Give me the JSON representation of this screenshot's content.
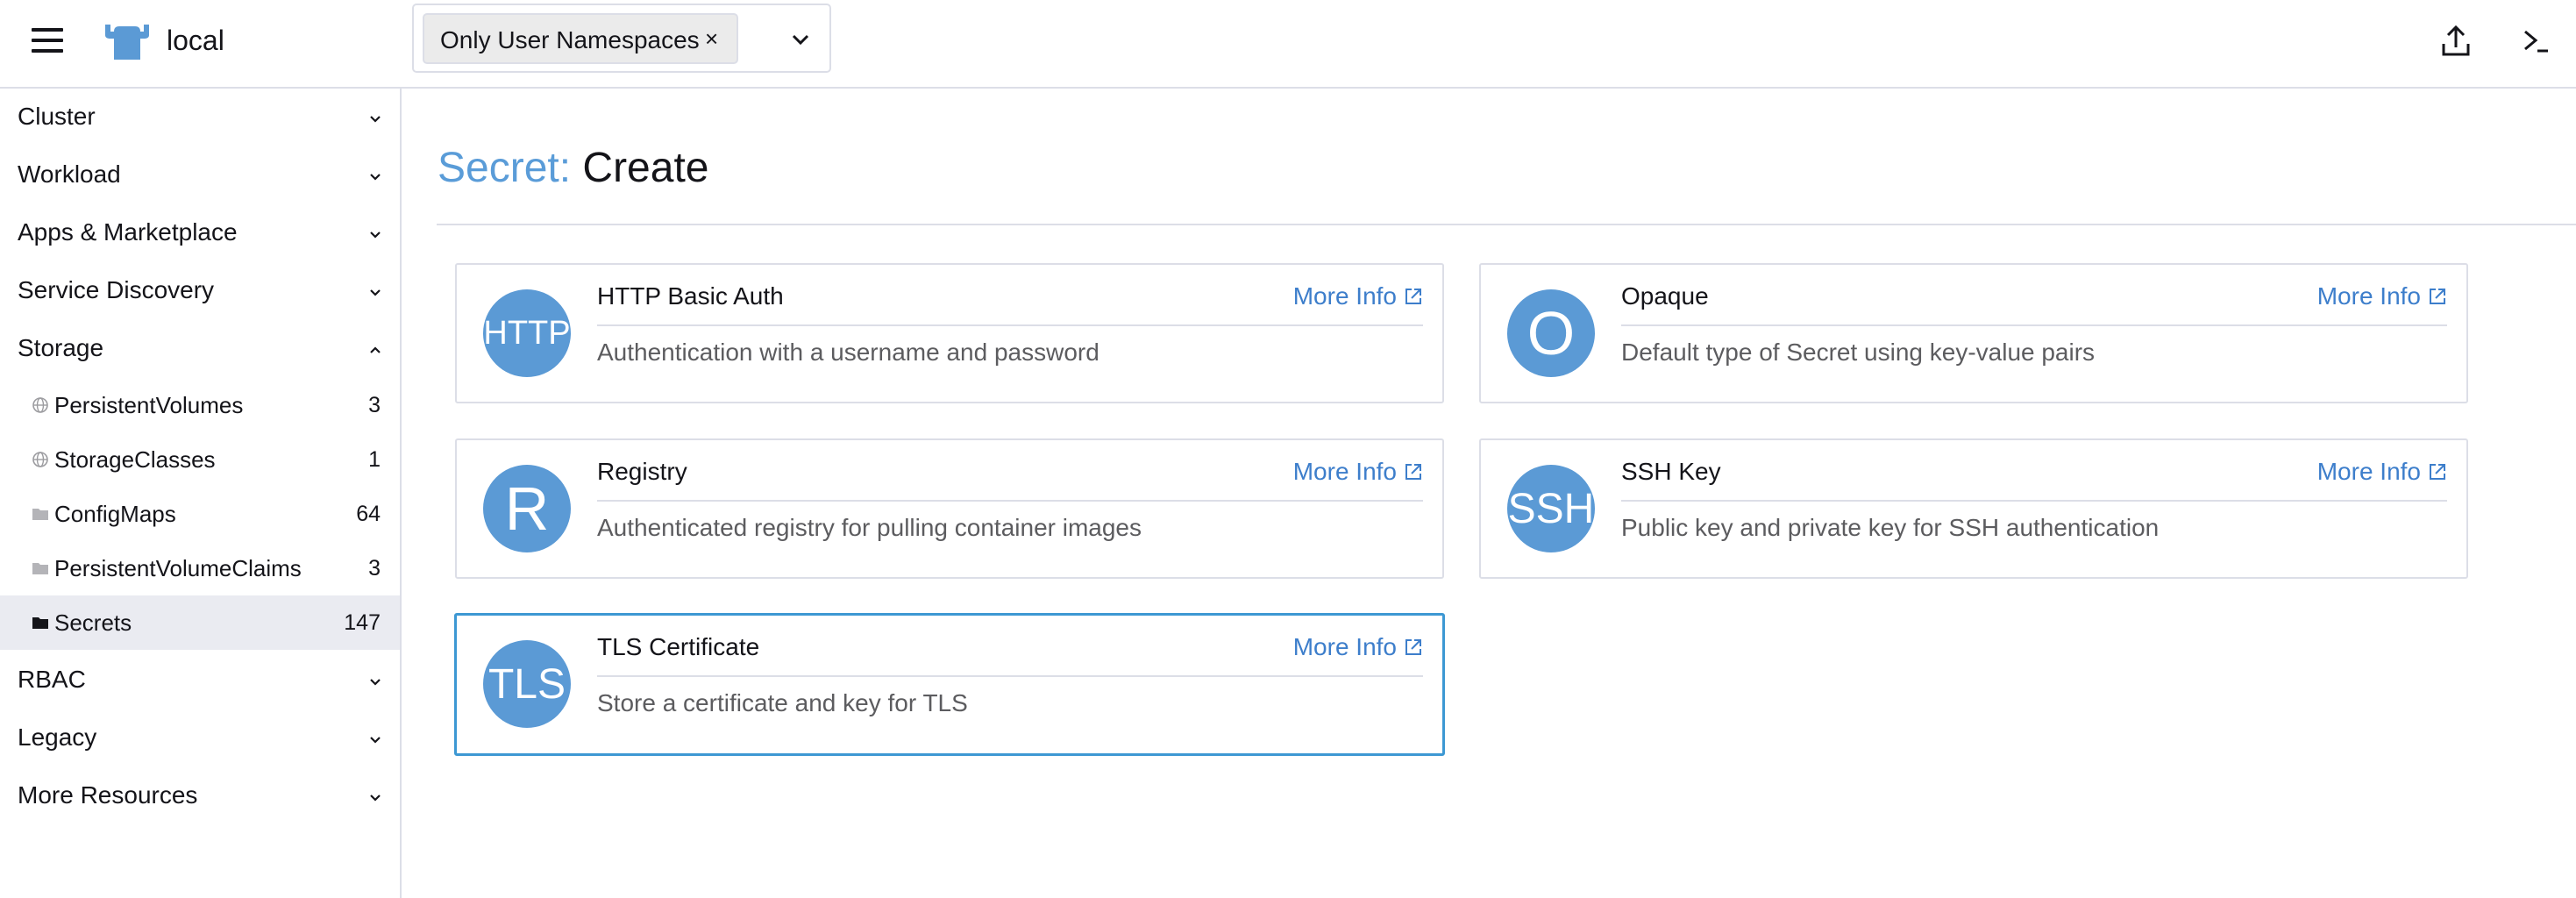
{
  "header": {
    "cluster_name": "local",
    "namespace_filter": {
      "selected_chip": "Only User Namespaces",
      "chip_close_glyph": "×"
    },
    "icons": [
      "menu-icon",
      "rancher-logo-icon",
      "chevron-down-icon",
      "import-yaml-icon",
      "kubectl-shell-icon"
    ]
  },
  "sidebar": {
    "groups": [
      {
        "label": "Cluster",
        "expanded": false
      },
      {
        "label": "Workload",
        "expanded": false
      },
      {
        "label": "Apps & Marketplace",
        "expanded": false
      },
      {
        "label": "Service Discovery",
        "expanded": false
      },
      {
        "label": "Storage",
        "expanded": true
      },
      {
        "label": "RBAC",
        "expanded": false
      },
      {
        "label": "Legacy",
        "expanded": false
      },
      {
        "label": "More Resources",
        "expanded": false
      }
    ],
    "storage_items": [
      {
        "label": "PersistentVolumes",
        "count": "3",
        "icon": "globe-icon",
        "active": false
      },
      {
        "label": "StorageClasses",
        "count": "1",
        "icon": "globe-icon",
        "active": false
      },
      {
        "label": "ConfigMaps",
        "count": "64",
        "icon": "folder-icon",
        "active": false
      },
      {
        "label": "PersistentVolumeClaims",
        "count": "3",
        "icon": "folder-icon",
        "active": false
      },
      {
        "label": "Secrets",
        "count": "147",
        "icon": "folder-icon",
        "active": true
      }
    ]
  },
  "main": {
    "title_prefix": "Secret:",
    "title_action": "Create",
    "more_info_label": "More Info",
    "cards": [
      {
        "badge": "HTTP",
        "title": "HTTP Basic Auth",
        "description": "Authentication with a username and password",
        "selected": false
      },
      {
        "badge": "O",
        "title": "Opaque",
        "description": "Default type of Secret using key-value pairs",
        "selected": false
      },
      {
        "badge": "R",
        "title": "Registry",
        "description": "Authenticated registry for pulling container images",
        "selected": false
      },
      {
        "badge": "SSH",
        "title": "SSH Key",
        "description": "Public key and private key for SSH authentication",
        "selected": false
      },
      {
        "badge": "TLS",
        "title": "TLS Certificate",
        "description": "Store a certificate and key for TLS",
        "selected": true
      }
    ]
  },
  "colors": {
    "accent": "#5a9cd8",
    "link": "#3d7ecb",
    "badge": "#5b9ad5",
    "border": "#dcdee7",
    "active_row": "#eaebf1",
    "selected_border": "#3d98d3"
  }
}
